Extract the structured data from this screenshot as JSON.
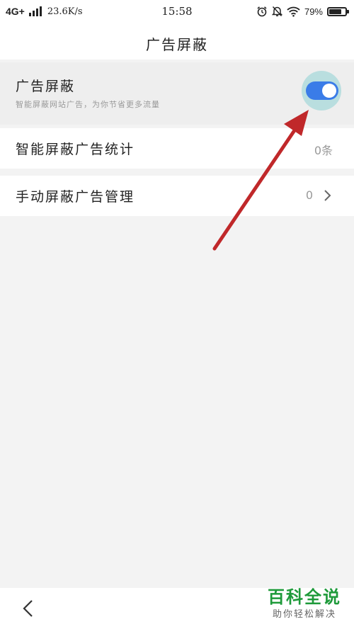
{
  "status_bar": {
    "network": "4G+",
    "speed": "23.6K/s",
    "time": "15:58",
    "battery": "79%",
    "battery_level": 0.79,
    "icons": [
      "signal-icon",
      "alarm-icon",
      "mute-icon",
      "wifi-icon",
      "battery-icon"
    ]
  },
  "header": {
    "title": "广告屏蔽"
  },
  "settings": {
    "ad_block": {
      "label": "广告屏蔽",
      "description": "智能屏蔽网站广告，为你节省更多流量",
      "enabled": true
    },
    "stats": {
      "label": "智能屏蔽广告统计",
      "value": "0条"
    },
    "manual": {
      "label": "手动屏蔽广告管理",
      "value": "0",
      "icon": "chevron-right-icon"
    }
  },
  "colors": {
    "toggle_on": "#3a7ce8",
    "toggle_halo": "#b9dedf",
    "annotation_arrow": "#c0282a",
    "watermark": "#1e9a3a"
  },
  "navigation": {
    "back_icon": "back-icon"
  },
  "watermark": {
    "brand": "百科全说",
    "tagline": "助你轻松解决"
  }
}
